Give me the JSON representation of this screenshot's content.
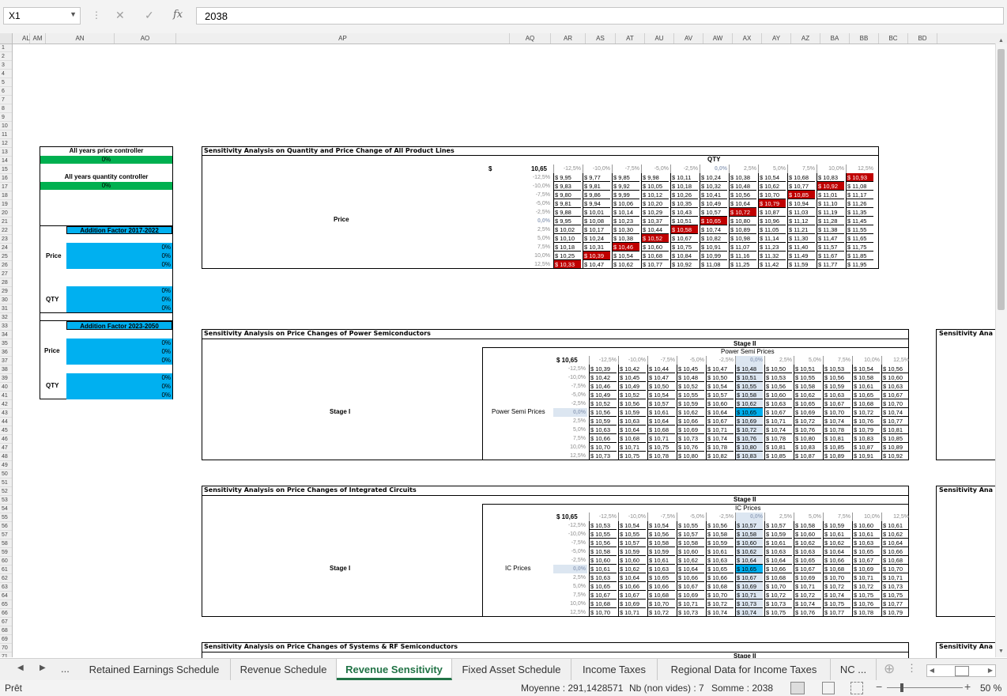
{
  "formula_bar": {
    "name_box": "X1",
    "cancel": "✕",
    "confirm": "✓",
    "fx": "fx",
    "value": "2038"
  },
  "columns": [
    "AL",
    "AM",
    "AN",
    "AO",
    "AP",
    "AQ",
    "AR",
    "AS",
    "AT",
    "AU",
    "AV",
    "AW",
    "AX",
    "AY",
    "AZ",
    "BA",
    "BB",
    "BC",
    "BD"
  ],
  "left_panel": {
    "price_controller_label": "All years price controller",
    "price_controller_value": "0%",
    "qty_controller_label": "All years quantity controller",
    "qty_controller_value": "0%",
    "factor1_title": "Addition Factor 2017-2022",
    "factor1_price_label": "Price",
    "factor1_price_values": [
      "0%",
      "0%",
      "0%"
    ],
    "factor1_qty_label": "QTY",
    "factor1_qty_values": [
      "0%",
      "0%",
      "0%"
    ],
    "factor2_title": "Addition Factor 2023-2050",
    "factor2_price_label": "Price",
    "factor2_price_values": [
      "0%",
      "0%",
      "0%"
    ],
    "factor2_qty_label": "QTY",
    "factor2_qty_values": [
      "0%",
      "0%",
      "0%"
    ]
  },
  "pcts": [
    "-12,5%",
    "-10,0%",
    "-7,5%",
    "-5,0%",
    "-2,5%",
    "0,0%",
    "2,5%",
    "5,0%",
    "7,5%",
    "10,0%",
    "12,5%"
  ],
  "section1": {
    "title": "Sensitivity Analysis on Quantity and Price Change of All Product Lines",
    "col_header": "QTY",
    "row_header": "Price",
    "corner_currency": "$",
    "corner_value": "10,65",
    "rows": [
      [
        "$ 9,95",
        "$ 9,77",
        "$ 9,85",
        "$ 9,98",
        "$ 10,11",
        "$ 10,24",
        "$ 10,38",
        "$ 10,54",
        "$ 10,68",
        "$ 10,83",
        "$ 10,93"
      ],
      [
        "$ 9,83",
        "$ 9,81",
        "$ 9,92",
        "$ 10,05",
        "$ 10,18",
        "$ 10,32",
        "$ 10,48",
        "$ 10,62",
        "$ 10,77",
        "$ 10,92",
        "$ 11,08"
      ],
      [
        "$ 9,80",
        "$ 9,86",
        "$ 9,99",
        "$ 10,12",
        "$ 10,26",
        "$ 10,41",
        "$ 10,56",
        "$ 10,70",
        "$ 10,85",
        "$ 11,01",
        "$ 11,17"
      ],
      [
        "$ 9,81",
        "$ 9,94",
        "$ 10,06",
        "$ 10,20",
        "$ 10,35",
        "$ 10,49",
        "$ 10,64",
        "$ 10,79",
        "$ 10,94",
        "$ 11,10",
        "$ 11,26"
      ],
      [
        "$ 9,88",
        "$ 10,01",
        "$ 10,14",
        "$ 10,29",
        "$ 10,43",
        "$ 10,57",
        "$ 10,72",
        "$ 10,87",
        "$ 11,03",
        "$ 11,19",
        "$ 11,35"
      ],
      [
        "$ 9,95",
        "$ 10,08",
        "$ 10,23",
        "$ 10,37",
        "$ 10,51",
        "$ 10,65",
        "$ 10,80",
        "$ 10,96",
        "$ 11,12",
        "$ 11,28",
        "$ 11,45"
      ],
      [
        "$ 10,02",
        "$ 10,17",
        "$ 10,30",
        "$ 10,44",
        "$ 10,58",
        "$ 10,74",
        "$ 10,89",
        "$ 11,05",
        "$ 11,21",
        "$ 11,38",
        "$ 11,55"
      ],
      [
        "$ 10,10",
        "$ 10,24",
        "$ 10,38",
        "$ 10,52",
        "$ 10,67",
        "$ 10,82",
        "$ 10,98",
        "$ 11,14",
        "$ 11,30",
        "$ 11,47",
        "$ 11,65"
      ],
      [
        "$ 10,18",
        "$ 10,31",
        "$ 10,46",
        "$ 10,60",
        "$ 10,75",
        "$ 10,91",
        "$ 11,07",
        "$ 11,23",
        "$ 11,40",
        "$ 11,57",
        "$ 11,75"
      ],
      [
        "$ 10,25",
        "$ 10,39",
        "$ 10,54",
        "$ 10,68",
        "$ 10,84",
        "$ 10,99",
        "$ 11,16",
        "$ 11,32",
        "$ 11,49",
        "$ 11,67",
        "$ 11,85"
      ],
      [
        "$ 10,33",
        "$ 10,47",
        "$ 10,62",
        "$ 10,77",
        "$ 10,92",
        "$ 11,08",
        "$ 11,25",
        "$ 11,42",
        "$ 11,59",
        "$ 11,77",
        "$ 11,95"
      ]
    ]
  },
  "section2": {
    "title": "Sensitivity Analysis on Price Changes of Power Semiconductors",
    "stage2": "Stage II",
    "sub_header": "Power Semi Prices",
    "stage1": "Stage I",
    "row_header": "Power Semi Prices",
    "corner_value": "$ 10,65",
    "rows": [
      [
        "$ 10,39",
        "$ 10,42",
        "$ 10,44",
        "$ 10,45",
        "$ 10,47",
        "$ 10,48",
        "$ 10,50",
        "$ 10,51",
        "$ 10,53",
        "$ 10,54",
        "$ 10,56"
      ],
      [
        "$ 10,42",
        "$ 10,45",
        "$ 10,47",
        "$ 10,48",
        "$ 10,50",
        "$ 10,51",
        "$ 10,53",
        "$ 10,55",
        "$ 10,56",
        "$ 10,58",
        "$ 10,60"
      ],
      [
        "$ 10,46",
        "$ 10,49",
        "$ 10,50",
        "$ 10,52",
        "$ 10,54",
        "$ 10,55",
        "$ 10,56",
        "$ 10,58",
        "$ 10,59",
        "$ 10,61",
        "$ 10,63"
      ],
      [
        "$ 10,49",
        "$ 10,52",
        "$ 10,54",
        "$ 10,55",
        "$ 10,57",
        "$ 10,58",
        "$ 10,60",
        "$ 10,62",
        "$ 10,63",
        "$ 10,65",
        "$ 10,67"
      ],
      [
        "$ 10,52",
        "$ 10,56",
        "$ 10,57",
        "$ 10,59",
        "$ 10,60",
        "$ 10,62",
        "$ 10,63",
        "$ 10,65",
        "$ 10,67",
        "$ 10,68",
        "$ 10,70"
      ],
      [
        "$ 10,56",
        "$ 10,59",
        "$ 10,61",
        "$ 10,62",
        "$ 10,64",
        "$ 10,65",
        "$ 10,67",
        "$ 10,69",
        "$ 10,70",
        "$ 10,72",
        "$ 10,74"
      ],
      [
        "$ 10,59",
        "$ 10,63",
        "$ 10,64",
        "$ 10,66",
        "$ 10,67",
        "$ 10,69",
        "$ 10,71",
        "$ 10,72",
        "$ 10,74",
        "$ 10,76",
        "$ 10,77"
      ],
      [
        "$ 10,63",
        "$ 10,64",
        "$ 10,68",
        "$ 10,69",
        "$ 10,71",
        "$ 10,72",
        "$ 10,74",
        "$ 10,76",
        "$ 10,78",
        "$ 10,79",
        "$ 10,81"
      ],
      [
        "$ 10,66",
        "$ 10,68",
        "$ 10,71",
        "$ 10,73",
        "$ 10,74",
        "$ 10,76",
        "$ 10,78",
        "$ 10,80",
        "$ 10,81",
        "$ 10,83",
        "$ 10,85"
      ],
      [
        "$ 10,70",
        "$ 10,71",
        "$ 10,75",
        "$ 10,76",
        "$ 10,78",
        "$ 10,80",
        "$ 10,81",
        "$ 10,83",
        "$ 10,85",
        "$ 10,87",
        "$ 10,89"
      ],
      [
        "$ 10,73",
        "$ 10,75",
        "$ 10,78",
        "$ 10,80",
        "$ 10,82",
        "$ 10,83",
        "$ 10,85",
        "$ 10,87",
        "$ 10,89",
        "$ 10,91",
        "$ 10,92"
      ]
    ]
  },
  "section3": {
    "title": "Sensitivity Analysis on Price Changes of Integrated Circuits",
    "stage2": "Stage II",
    "sub_header": "IC Prices",
    "stage1": "Stage I",
    "row_header": "IC Prices",
    "corner_value": "$ 10,65",
    "rows": [
      [
        "$ 10,53",
        "$ 10,54",
        "$ 10,54",
        "$ 10,55",
        "$ 10,56",
        "$ 10,57",
        "$ 10,57",
        "$ 10,58",
        "$ 10,59",
        "$ 10,60",
        "$ 10,61"
      ],
      [
        "$ 10,55",
        "$ 10,55",
        "$ 10,56",
        "$ 10,57",
        "$ 10,58",
        "$ 10,58",
        "$ 10,59",
        "$ 10,60",
        "$ 10,61",
        "$ 10,61",
        "$ 10,62"
      ],
      [
        "$ 10,56",
        "$ 10,57",
        "$ 10,58",
        "$ 10,58",
        "$ 10,59",
        "$ 10,60",
        "$ 10,61",
        "$ 10,62",
        "$ 10,62",
        "$ 10,63",
        "$ 10,64"
      ],
      [
        "$ 10,58",
        "$ 10,59",
        "$ 10,59",
        "$ 10,60",
        "$ 10,61",
        "$ 10,62",
        "$ 10,63",
        "$ 10,63",
        "$ 10,64",
        "$ 10,65",
        "$ 10,66"
      ],
      [
        "$ 10,60",
        "$ 10,60",
        "$ 10,61",
        "$ 10,62",
        "$ 10,63",
        "$ 10,64",
        "$ 10,64",
        "$ 10,65",
        "$ 10,66",
        "$ 10,67",
        "$ 10,68"
      ],
      [
        "$ 10,61",
        "$ 10,62",
        "$ 10,63",
        "$ 10,64",
        "$ 10,65",
        "$ 10,65",
        "$ 10,66",
        "$ 10,67",
        "$ 10,68",
        "$ 10,69",
        "$ 10,70"
      ],
      [
        "$ 10,63",
        "$ 10,64",
        "$ 10,65",
        "$ 10,66",
        "$ 10,66",
        "$ 10,67",
        "$ 10,68",
        "$ 10,69",
        "$ 10,70",
        "$ 10,71",
        "$ 10,71"
      ],
      [
        "$ 10,65",
        "$ 10,66",
        "$ 10,66",
        "$ 10,67",
        "$ 10,68",
        "$ 10,69",
        "$ 10,70",
        "$ 10,71",
        "$ 10,72",
        "$ 10,72",
        "$ 10,73"
      ],
      [
        "$ 10,67",
        "$ 10,67",
        "$ 10,68",
        "$ 10,69",
        "$ 10,70",
        "$ 10,71",
        "$ 10,72",
        "$ 10,72",
        "$ 10,74",
        "$ 10,75",
        "$ 10,75"
      ],
      [
        "$ 10,68",
        "$ 10,69",
        "$ 10,70",
        "$ 10,71",
        "$ 10,72",
        "$ 10,73",
        "$ 10,73",
        "$ 10,74",
        "$ 10,75",
        "$ 10,76",
        "$ 10,77"
      ],
      [
        "$ 10,70",
        "$ 10,71",
        "$ 10,72",
        "$ 10,73",
        "$ 10,74",
        "$ 10,74",
        "$ 10,75",
        "$ 10,76",
        "$ 10,77",
        "$ 10,78",
        "$ 10,79"
      ]
    ]
  },
  "section4": {
    "title": "Sensitivity Analysis on Price Changes of Systems & RF Semiconductors",
    "stage2": "Stage II"
  },
  "right_stub_title": "Sensitivity Ana",
  "tabs": {
    "ellipsis": "...",
    "items": [
      "Retained Earnings Schedule",
      "Revenue Schedule",
      "Revenue Sensitivity",
      "Fixed Asset Schedule",
      "Income Taxes",
      "Regional Data for Income Taxes",
      "NC ..."
    ],
    "active": "Revenue Sensitivity"
  },
  "status": {
    "ready": "Prêt",
    "average": "Moyenne : 291,1428571",
    "count": "Nb (non vides) : 7",
    "sum": "Somme : 2038",
    "zoom": "50 %"
  },
  "colors": {
    "green": "#00b050",
    "blue": "#00b0f0",
    "red_highlight": "#c00000",
    "light_blue": "#dce6f1",
    "excel_green": "#217346"
  }
}
